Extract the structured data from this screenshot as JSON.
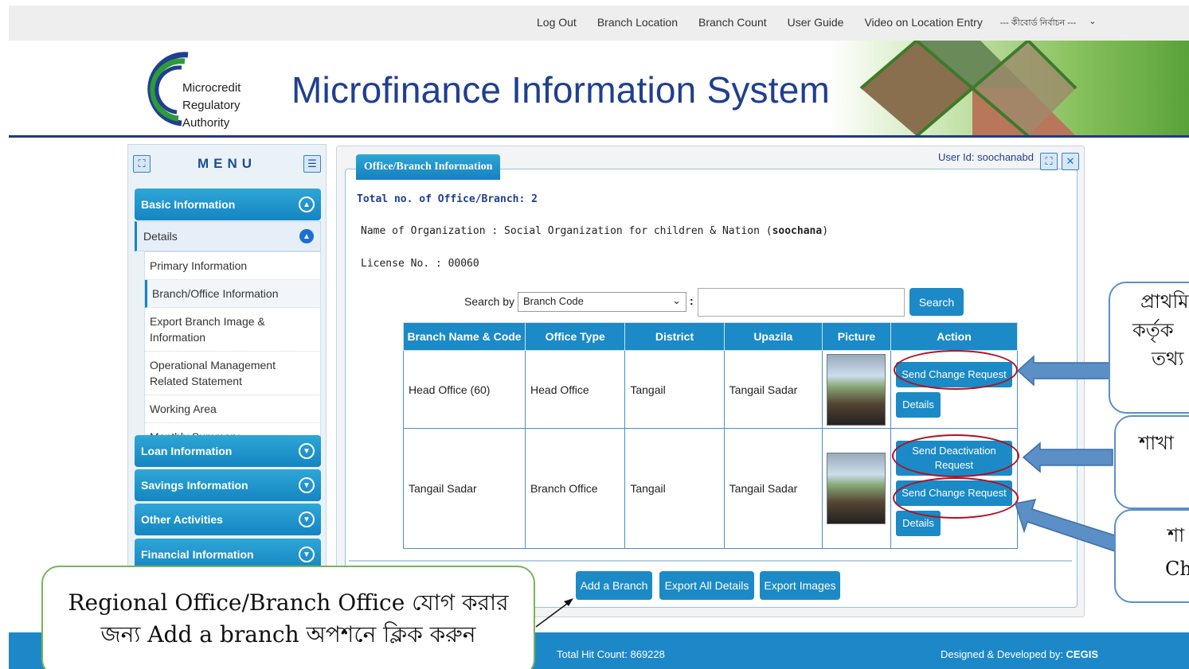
{
  "top_nav": {
    "logout": "Log Out",
    "branch_location": "Branch Location",
    "branch_count": "Branch Count",
    "user_guide": "User Guide",
    "video": "Video on Location Entry",
    "select": "--- কীবোর্ড নির্বাচন ---"
  },
  "header": {
    "logo_line1": "Microcredit",
    "logo_line2": "Regulatory",
    "logo_line3": "Authority",
    "title": "Microfinance Information System"
  },
  "menu": {
    "title": "MENU",
    "categories": [
      "Basic Information",
      "Loan Information",
      "Savings Information",
      "Other Activities",
      "Financial Information"
    ],
    "details_label": "Details",
    "sub_items": [
      "Primary Information",
      "Branch/Office Information",
      "Export Branch Image & Information",
      "Operational Management Related Statement",
      "Working Area",
      "Monthly Summary"
    ]
  },
  "panel": {
    "tab": "Office/Branch Information",
    "user_id": "User Id: soochanabd",
    "total": "Total no. of Office/Branch: 2",
    "org_prefix": "Name of Organization : Social Organization for children & Nation (",
    "org_bold": "soochana",
    "org_suffix": ")",
    "license": "License No. : 00060",
    "search_label": "Search by",
    "search_select": "Branch Code",
    "search_button": "Search"
  },
  "table": {
    "headers": [
      "Branch Name & Code",
      "Office Type",
      "District",
      "Upazila",
      "Picture",
      "Action"
    ],
    "rows": [
      {
        "name": "Head Office (60)",
        "type": "Head Office",
        "district": "Tangail",
        "upazila": "Tangail Sadar"
      },
      {
        "name": "Tangail Sadar",
        "type": "Branch Office",
        "district": "Tangail",
        "upazila": "Tangail Sadar"
      }
    ],
    "send_change": "Send Change Request",
    "send_deactivation": "Send Deactivation Request",
    "details": "Details"
  },
  "bottom_buttons": {
    "add": "Add a Branch",
    "export_all": "Export All Details",
    "export_images": "Export Images"
  },
  "footer": {
    "hit_count": "Total Hit Count: 869228",
    "designed_prefix": "Designed & Developed by: ",
    "designed_by": "CEGIS"
  },
  "callouts": {
    "left_line1": "Regional Office/Branch Office যোগ করার",
    "left_line2": "জন্য Add a branch অপশনে ক্লিক করুন",
    "right1_line1": "প্রাথমি",
    "right1_line2": "কর্তৃক",
    "right1_line3": "তথ্য",
    "right2_line1": "শাখা",
    "right3_line1": "শা",
    "right3_line2": "Ch"
  },
  "colors": {
    "primary": "#1b8ac6",
    "title": "#1f3f8f",
    "highlight_oval": "#b21020",
    "callout_green": "#7ab356",
    "callout_blue": "#5b8fc6"
  }
}
